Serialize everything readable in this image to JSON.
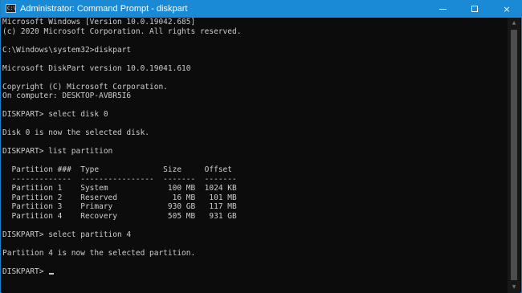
{
  "window": {
    "title": "Administrator: Command Prompt - diskpart",
    "icon_label": "C:\\",
    "controls": {
      "minimize": "minimize",
      "maximize": "maximize",
      "close": "×"
    },
    "titlebar_color": "#1a8ad6",
    "console_background": "#0c0c0c",
    "console_text_color": "#cccccc"
  },
  "console": {
    "lines": [
      "Microsoft Windows [Version 10.0.19042.685]",
      "(c) 2020 Microsoft Corporation. All rights reserved.",
      "",
      "C:\\Windows\\system32>diskpart",
      "",
      "Microsoft DiskPart version 10.0.19041.610",
      "",
      "Copyright (C) Microsoft Corporation.",
      "On computer: DESKTOP-AVBR5I6",
      "",
      "DISKPART> select disk 0",
      "",
      "Disk 0 is now the selected disk.",
      "",
      "DISKPART> list partition",
      "",
      "  Partition ###  Type              Size     Offset",
      "  -------------  ----------------  -------  -------",
      "  Partition 1    System             100 MB  1024 KB",
      "  Partition 2    Reserved            16 MB   101 MB",
      "  Partition 3    Primary            930 GB   117 MB",
      "  Partition 4    Recovery           505 MB   931 GB",
      "",
      "DISKPART> select partition 4",
      "",
      "Partition 4 is now the selected partition.",
      "",
      "DISKPART> "
    ]
  },
  "scrollbar": {
    "up_icon": "▲",
    "down_icon": "▼"
  }
}
